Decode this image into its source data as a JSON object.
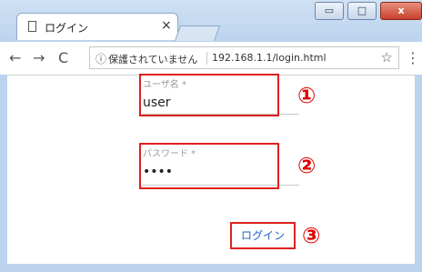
{
  "tab": {
    "title": "ログイン",
    "close": "×"
  },
  "window_controls": {
    "minimize": "▭",
    "maximize": "□",
    "close": "x"
  },
  "nav": {
    "back": "←",
    "forward": "→",
    "reload": "C"
  },
  "address": {
    "info_icon": "ⓘ",
    "security_text": "保護されていません",
    "url": "192.168.1.1/login.html",
    "star": "☆",
    "menu": "⋮"
  },
  "form": {
    "username": {
      "label": "ユーザ名 *",
      "value": "user"
    },
    "password": {
      "label": "パスワード *",
      "value": "••••"
    },
    "login_button": "ログイン"
  },
  "annotations": {
    "one": "①",
    "two": "②",
    "three": "③"
  },
  "colors": {
    "annotation": "#e00000",
    "link": "#1a62c8"
  }
}
